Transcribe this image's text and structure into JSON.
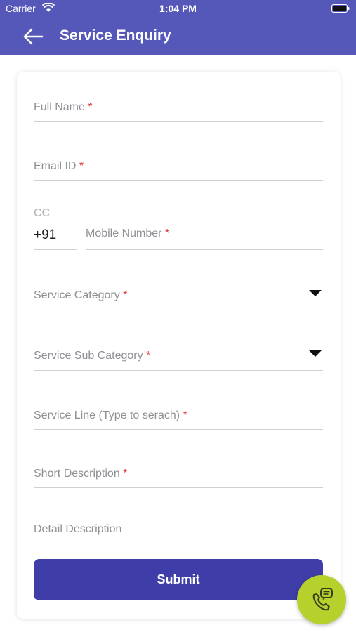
{
  "status_bar": {
    "carrier": "Carrier",
    "time": "1:04 PM"
  },
  "header": {
    "title": "Service Enquiry",
    "back_icon": "arrow-left-icon"
  },
  "form": {
    "full_name": "Full Name",
    "email": "Email ID",
    "cc_label": "CC",
    "cc_value": "+91",
    "mobile": "Mobile Number",
    "service_category": "Service Category",
    "service_sub_category": "Service Sub Category",
    "service_line": "Service Line (Type to serach)",
    "short_description": "Short Description",
    "detail_description": "Detail Description",
    "required_mark": "*"
  },
  "submit_label": "Submit",
  "fab_icon": "phone-chat-icon",
  "colors": {
    "header": "#5558b8",
    "button": "#3f3ea8",
    "fab": "#b6d12c",
    "required": "#e53935"
  }
}
